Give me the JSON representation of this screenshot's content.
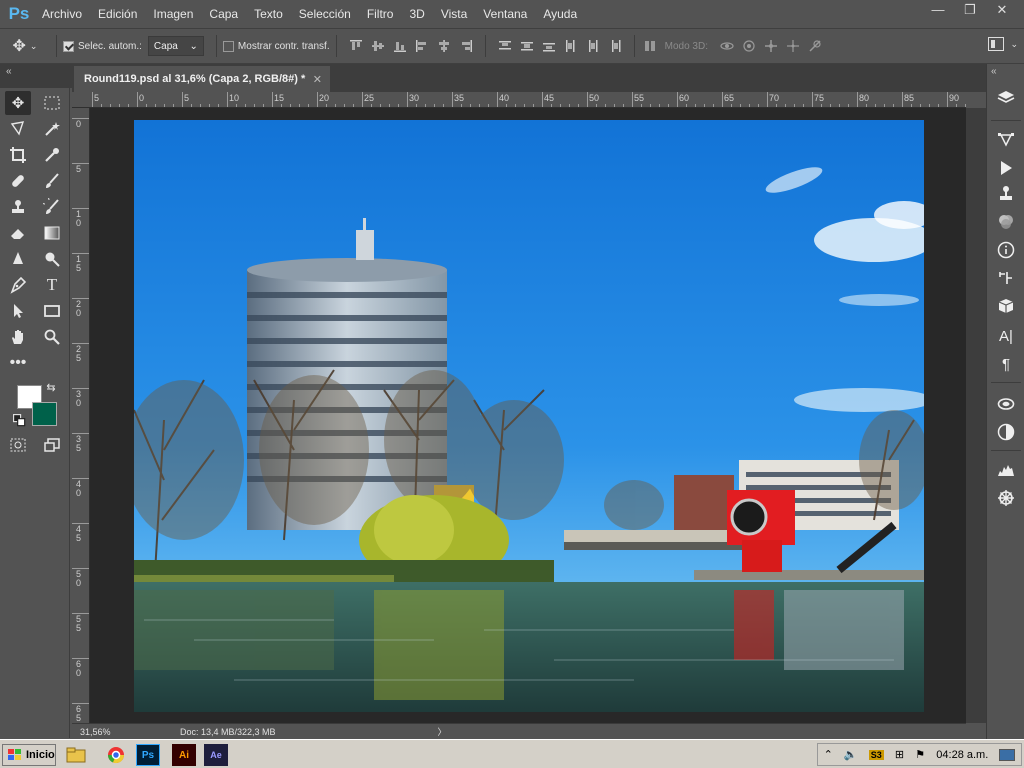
{
  "app": {
    "logo": "Ps"
  },
  "menu": [
    "Archivo",
    "Edición",
    "Imagen",
    "Capa",
    "Texto",
    "Selección",
    "Filtro",
    "3D",
    "Vista",
    "Ventana",
    "Ayuda"
  ],
  "window_controls": {
    "minimize": "—",
    "restore": "❐",
    "close": "✕"
  },
  "options": {
    "auto_select_label": "Selec. autom.:",
    "auto_select_checked": true,
    "target_value": "Capa",
    "show_transform_label": "Mostrar contr. transf.",
    "show_transform_checked": false,
    "mode3d_label": "Modo 3D:"
  },
  "tab": {
    "title": "Round119.psd al 31,6% (Capa 2, RGB/8#) *",
    "close": "✕"
  },
  "panel_collapse": "«",
  "ruler": {
    "h_labels": [
      "5",
      "0",
      "5",
      "10",
      "15",
      "20",
      "25",
      "30",
      "35",
      "40",
      "45",
      "50",
      "55",
      "60",
      "65",
      "70",
      "75",
      "80",
      "85",
      "90"
    ],
    "v_labels": [
      "0",
      "5",
      "1\n0",
      "1\n5",
      "2\n0",
      "2\n5",
      "3\n0",
      "3\n5",
      "4\n0",
      "4\n5",
      "5\n0",
      "5\n5",
      "6\n0",
      "6\n5"
    ]
  },
  "colors": {
    "foreground": "#ffffff",
    "background": "#00614a",
    "accent": "#31a8ff"
  },
  "status": {
    "zoom": "31,56%",
    "doc": "Doc: 13,4 MB/322,3 MB",
    "arrow": "〉"
  },
  "taskbar": {
    "start_label": "Inicio",
    "time": "04:28 a.m.",
    "apps": [
      "explorer-icon",
      "chrome-icon",
      "photoshop-icon",
      "illustrator-icon",
      "after-effects-icon"
    ]
  }
}
